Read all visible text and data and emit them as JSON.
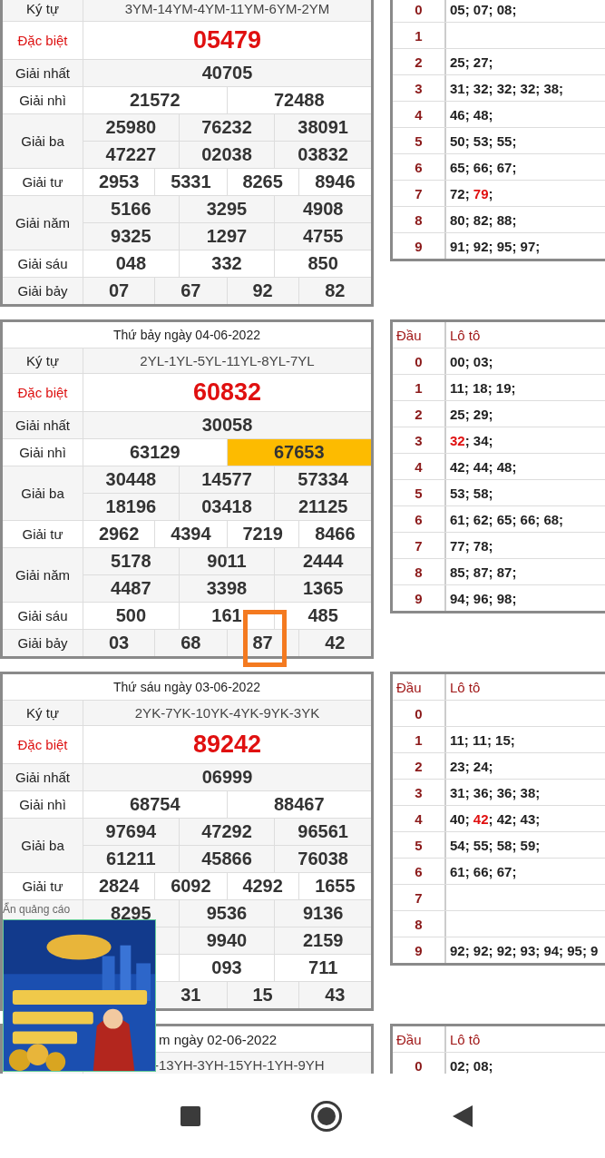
{
  "draws": [
    {
      "covered_left": false,
      "prizes": [
        {
          "kind": "code",
          "label": "Ký tự",
          "lines": [
            [
              "3YM-14YM-4YM-11YM-6YM-2YM"
            ]
          ]
        },
        {
          "kind": "special",
          "label": "Đặc biệt",
          "lines": [
            [
              "05479"
            ]
          ]
        },
        {
          "kind": "prize",
          "label": "Giải nhất",
          "lines": [
            [
              "40705"
            ]
          ]
        },
        {
          "kind": "prize",
          "label": "Giải nhì",
          "lines": [
            [
              "21572",
              "72488"
            ]
          ]
        },
        {
          "kind": "prize",
          "label": "Giải ba",
          "lines": [
            [
              "25980",
              "76232",
              "38091"
            ],
            [
              "47227",
              "02038",
              "03832"
            ]
          ]
        },
        {
          "kind": "prize",
          "label": "Giải tư",
          "lines": [
            [
              "2953",
              "5331",
              "8265",
              "8946"
            ]
          ]
        },
        {
          "kind": "prize",
          "label": "Giải năm",
          "lines": [
            [
              "5166",
              "3295",
              "4908"
            ],
            [
              "9325",
              "1297",
              "4755"
            ]
          ]
        },
        {
          "kind": "prize",
          "label": "Giải sáu",
          "lines": [
            [
              "048",
              "332",
              "850"
            ]
          ]
        },
        {
          "kind": "prize",
          "label": "Giải bảy",
          "lines": [
            [
              "07",
              "67",
              "92",
              "82"
            ]
          ]
        }
      ],
      "loto": {
        "rows": [
          {
            "head": "0",
            "text": "05; 07; 08;"
          },
          {
            "head": "1"
          },
          {
            "head": "2",
            "text": "25; 27;"
          },
          {
            "head": "3",
            "text": "31; 32; 32; 32; 38;"
          },
          {
            "head": "4",
            "text": "46; 48;"
          },
          {
            "head": "5",
            "text": "50; 53; 55;"
          },
          {
            "head": "6",
            "text": "65; 66; 67;"
          },
          {
            "head": "7",
            "text": "72; ",
            "special": "79",
            "after": ";"
          },
          {
            "head": "8",
            "text": "80; 82; 88;"
          },
          {
            "head": "9",
            "text": "91; 92; 95; 97;"
          }
        ]
      }
    },
    {
      "header": "Thứ bảy ngày 04-06-2022",
      "covered_left": false,
      "prizes": [
        {
          "kind": "code",
          "label": "Ký tự",
          "lines": [
            [
              "2YL-1YL-5YL-11YL-8YL-7YL"
            ]
          ]
        },
        {
          "kind": "special",
          "label": "Đặc biệt",
          "lines": [
            [
              "60832"
            ]
          ]
        },
        {
          "kind": "prize",
          "label": "Giải nhất",
          "lines": [
            [
              "30058"
            ]
          ]
        },
        {
          "kind": "prize",
          "label": "Giải nhì",
          "lines": [
            [
              "63129",
              {
                "text": "67653",
                "highlighted": true
              }
            ]
          ]
        },
        {
          "kind": "prize",
          "label": "Giải ba",
          "lines": [
            [
              "30448",
              "14577",
              "57334"
            ],
            [
              "18196",
              "03418",
              "21125"
            ]
          ]
        },
        {
          "kind": "prize",
          "label": "Giải tư",
          "lines": [
            [
              "2962",
              "4394",
              "7219",
              "8466"
            ]
          ]
        },
        {
          "kind": "prize",
          "label": "Giải năm",
          "lines": [
            [
              "5178",
              "9011",
              "2444"
            ],
            [
              "4487",
              "3398",
              "1365"
            ]
          ]
        },
        {
          "kind": "prize",
          "label": "Giải sáu",
          "lines": [
            [
              "500",
              "161",
              "485"
            ]
          ]
        },
        {
          "kind": "prize",
          "label": "Giải bảy",
          "lines": [
            [
              "03",
              "68",
              {
                "text": "87",
                "framed": true
              },
              "42"
            ]
          ]
        }
      ],
      "loto": {
        "header": {
          "head": "Đầu",
          "numbers": "Lô tô"
        },
        "rows": [
          {
            "head": "0",
            "text": "00; 03;"
          },
          {
            "head": "1",
            "text": "11; 18; 19;"
          },
          {
            "head": "2",
            "text": "25; 29;"
          },
          {
            "head": "3",
            "text": "",
            "special": "32",
            "after": "; 34;"
          },
          {
            "head": "4",
            "text": "42; 44; 48;"
          },
          {
            "head": "5",
            "text": "53; 58;"
          },
          {
            "head": "6",
            "text": "61; 62; 65; 66; 68;"
          },
          {
            "head": "7",
            "text": "77; 78;"
          },
          {
            "head": "8",
            "text": "85; 87; 87;"
          },
          {
            "head": "9",
            "text": "94; 96; 98;"
          }
        ]
      }
    },
    {
      "header": "Thứ sáu ngày 03-06-2022",
      "covered_left": false,
      "prizes": [
        {
          "kind": "code",
          "label": "Ký tự",
          "lines": [
            [
              "2YK-7YK-10YK-4YK-9YK-3YK"
            ]
          ]
        },
        {
          "kind": "special",
          "label": "Đặc biệt",
          "lines": [
            [
              "89242"
            ]
          ]
        },
        {
          "kind": "prize",
          "label": "Giải nhất",
          "lines": [
            [
              "06999"
            ]
          ]
        },
        {
          "kind": "prize",
          "label": "Giải nhì",
          "lines": [
            [
              "68754",
              "88467"
            ]
          ]
        },
        {
          "kind": "prize",
          "label": "Giải ba",
          "lines": [
            [
              "97694",
              "47292",
              "96561"
            ],
            [
              "61211",
              "45866",
              "76038"
            ]
          ]
        },
        {
          "kind": "prize",
          "label": "Giải tư",
          "lines": [
            [
              "2824",
              "6092",
              "4292",
              "1655"
            ]
          ]
        },
        {
          "kind": "prize",
          "lines": [
            [
              "8295",
              "9536",
              "9136"
            ],
            [
              "9940",
              "2159"
            ]
          ],
          "covered_lines": [
            false,
            true
          ]
        },
        {
          "kind": "prize",
          "lines": [
            [
              "093",
              "711"
            ]
          ],
          "covered_lines": [
            true
          ]
        },
        {
          "kind": "prize",
          "lines": [
            [
              "31",
              "15",
              "43"
            ]
          ],
          "covered_lines": [
            true
          ]
        }
      ],
      "loto": {
        "header": {
          "head": "Đầu",
          "numbers": "Lô tô"
        },
        "rows": [
          {
            "head": "0"
          },
          {
            "head": "1",
            "text": "11; 11; 15;"
          },
          {
            "head": "2",
            "text": "23; 24;"
          },
          {
            "head": "3",
            "text": "31; 36; 36; 38;"
          },
          {
            "head": "4",
            "text": "40; ",
            "special": "42",
            "after": "; 42; 43;"
          },
          {
            "head": "5",
            "text": "54; 55; 58; 59;"
          },
          {
            "head": "6",
            "text": "61; 66; 67;"
          },
          {
            "head": "7"
          },
          {
            "head": "8"
          },
          {
            "head": "9",
            "text": "92; 92; 92; 93; 94; 95; 9"
          }
        ]
      }
    },
    {
      "header": "m ngày 02-06-2022",
      "covered_left": true,
      "prizes": [
        {
          "kind": "code",
          "lines": [
            [
              "-13YH-3YH-15YH-1YH-9YH"
            ]
          ]
        }
      ],
      "loto": {
        "header": {
          "head": "Đầu",
          "numbers": "Lô tô"
        },
        "rows": [
          {
            "head": "0",
            "text": "02; 08;"
          }
        ]
      }
    }
  ],
  "ad": {
    "hide_link": "Ẩn quảng cáo"
  }
}
